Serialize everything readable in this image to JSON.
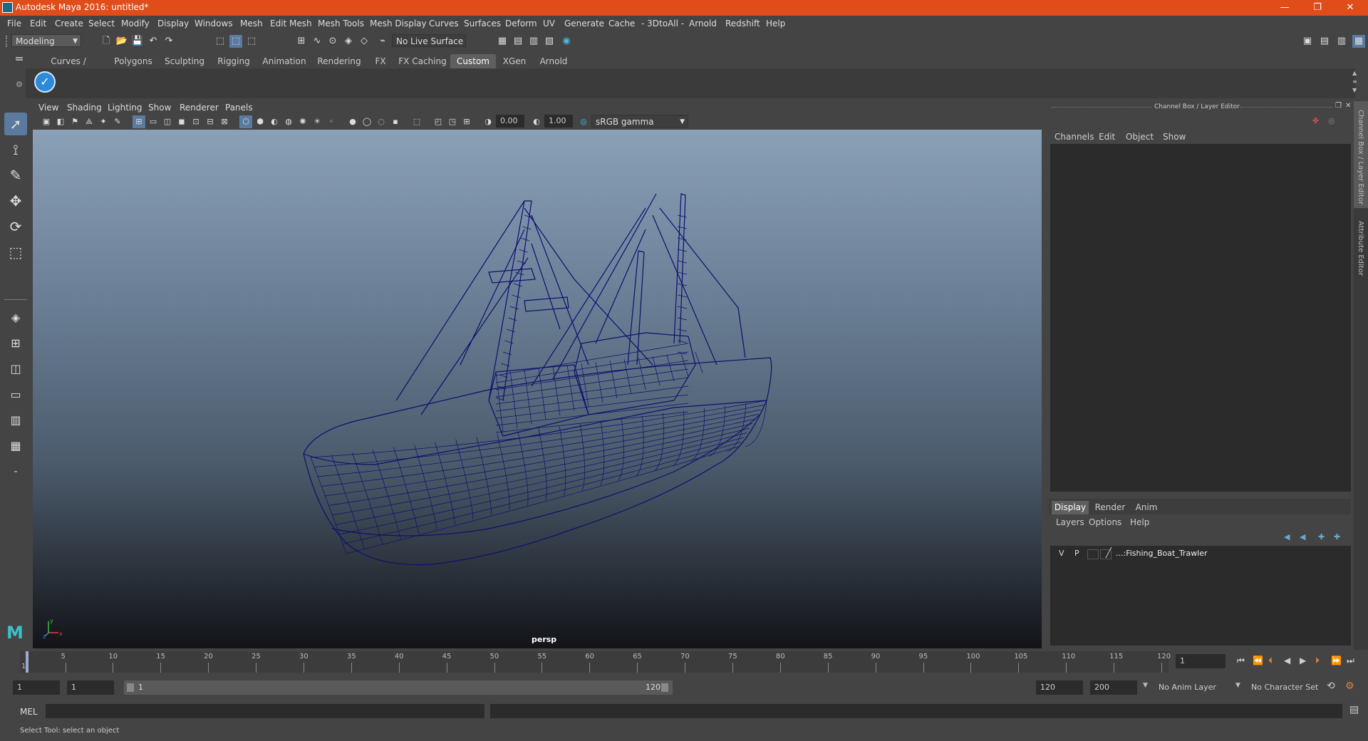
{
  "window": {
    "title": "Autodesk Maya 2016: untitled*",
    "min": "—",
    "max": "❐",
    "close": "✕"
  },
  "menubar": [
    "File",
    "Edit",
    "Create",
    "Select",
    "Modify",
    "Display",
    "Windows",
    "Mesh",
    "Edit Mesh",
    "Mesh Tools",
    "Mesh Display",
    "Curves",
    "Surfaces",
    "Deform",
    "UV",
    "Generate",
    "Cache",
    "- 3DtoAll -",
    "Arnold",
    "Redshift",
    "Help"
  ],
  "statusline": {
    "menu_set": "Modeling",
    "live_surface": "No Live Surface"
  },
  "shelf": {
    "tabs": [
      "Curves / Surfaces",
      "Polygons",
      "Sculpting",
      "Rigging",
      "Animation",
      "Rendering",
      "FX",
      "FX Caching",
      "Custom",
      "XGen",
      "Arnold"
    ],
    "active_tab": "Custom"
  },
  "viewport": {
    "menu": [
      "View",
      "Shading",
      "Lighting",
      "Show",
      "Renderer",
      "Panels"
    ],
    "exposure": "0.00",
    "gamma": "1.00",
    "color_space": "sRGB gamma",
    "camera_label": "persp",
    "model_wire_color": "#0e0e6e",
    "axis": {
      "x": "x",
      "y": "y",
      "z": "z"
    }
  },
  "channel_box": {
    "title": "Channel Box / Layer Editor",
    "menu": [
      "Channels",
      "Edit",
      "Object",
      "Show"
    ],
    "side_tabs": [
      "Channel Box / Layer Editor",
      "Attribute Editor"
    ]
  },
  "layer_editor": {
    "tabs": [
      "Display",
      "Render",
      "Anim"
    ],
    "active_tab": "Display",
    "menu": [
      "Layers",
      "Options",
      "Help"
    ],
    "layers": [
      {
        "v": "V",
        "p": "P",
        "name": "...:Fishing_Boat_Trawler"
      }
    ]
  },
  "timeline": {
    "labels": [
      "1",
      "5",
      "10",
      "15",
      "20",
      "25",
      "30",
      "35",
      "40",
      "45",
      "50",
      "55",
      "60",
      "65",
      "70",
      "75",
      "80",
      "85",
      "90",
      "95",
      "100",
      "105",
      "110",
      "115",
      "120"
    ],
    "current_frame": "1"
  },
  "range": {
    "start": "1",
    "playback_start": "1",
    "slider_start": "1",
    "slider_end": "120",
    "playback_end": "120",
    "end": "200",
    "anim_layer": "No Anim Layer",
    "character_set": "No Character Set"
  },
  "command_line": {
    "label": "MEL"
  },
  "help_line": "Select Tool: select an object"
}
